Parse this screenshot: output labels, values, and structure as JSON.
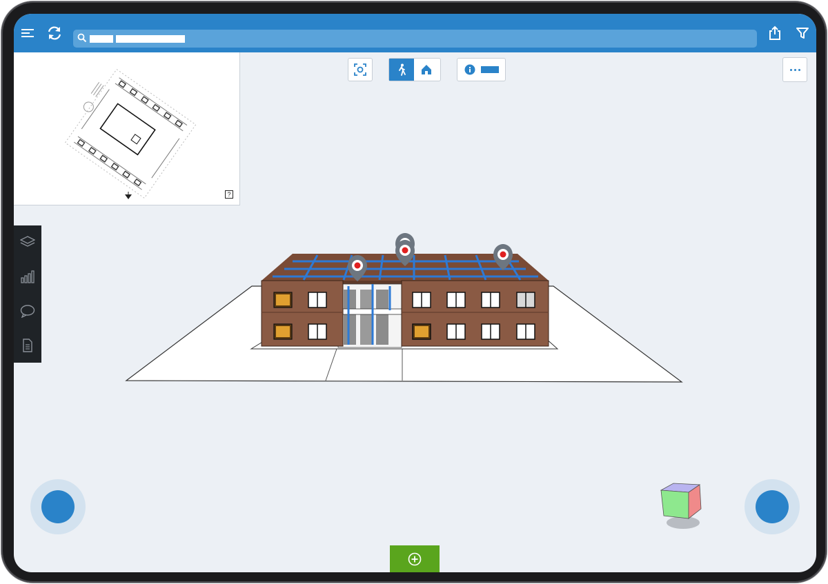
{
  "app": {
    "colors": {
      "primary": "#2a83c9",
      "toolbar": "#2a83c9",
      "search_bg": "#5aa3da",
      "background": "#ecf0f5",
      "panel_dark": "#1f2327",
      "add_green": "#5aa51d",
      "brick": "#8a5a44",
      "pin_red": "#e02020"
    }
  },
  "topbar": {
    "menu_icon": "hamburger-menu-icon",
    "sync_icon": "refresh-sync-icon",
    "search": {
      "icon": "search-icon",
      "value": ""
    },
    "share_icon": "share-upload-icon",
    "filter_icon": "funnel-filter-icon"
  },
  "minimap": {
    "help_label": "?"
  },
  "toolbar": {
    "focus_icon": "focus-scan-icon",
    "walk_icon": "walk-person-icon",
    "home_icon": "home-icon",
    "info_icon": "info-icon",
    "more_icon": "more-dots-icon"
  },
  "leftpanel": {
    "items": [
      {
        "icon": "layers-icon"
      },
      {
        "icon": "bar-chart-icon"
      },
      {
        "icon": "comment-bubble-icon"
      },
      {
        "icon": "document-icon"
      }
    ]
  },
  "bottom": {
    "add_icon": "plus-circle-icon"
  }
}
